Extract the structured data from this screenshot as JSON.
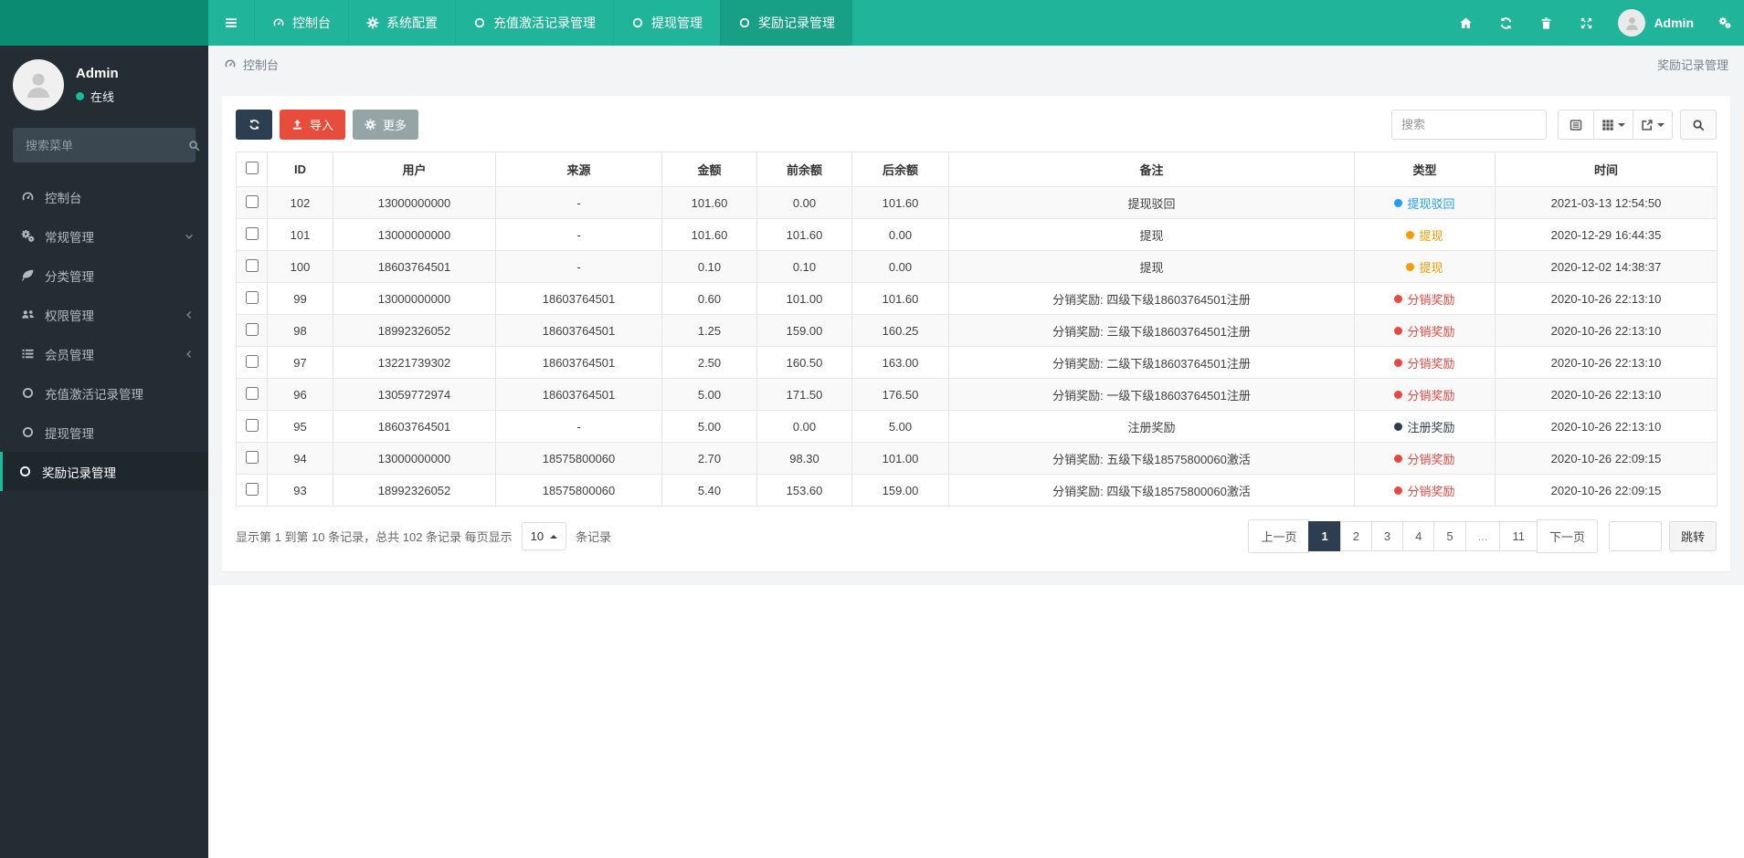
{
  "topnav": {
    "menu_icon": "menu",
    "items": [
      {
        "label": "控制台",
        "icon": "dashboard",
        "active": false
      },
      {
        "label": "系统配置",
        "icon": "gear",
        "active": false
      },
      {
        "label": "充值激活记录管理",
        "icon": "circle",
        "active": false
      },
      {
        "label": "提现管理",
        "icon": "circle",
        "active": false
      },
      {
        "label": "奖励记录管理",
        "icon": "circle",
        "active": true
      }
    ],
    "right_icons": [
      "home",
      "refresh",
      "trash",
      "expand"
    ],
    "user_name": "Admin",
    "settings_icon": "cogs"
  },
  "sidebar": {
    "user": {
      "name": "Admin",
      "status": "在线"
    },
    "search_placeholder": "搜索菜单",
    "search_icon": "search",
    "items": [
      {
        "label": "控制台",
        "icon": "dashboard"
      },
      {
        "label": "常规管理",
        "icon": "cogs",
        "chevron": "down"
      },
      {
        "label": "分类管理",
        "icon": "leaf"
      },
      {
        "label": "权限管理",
        "icon": "users",
        "chevron": "left"
      },
      {
        "label": "会员管理",
        "icon": "list",
        "chevron": "left"
      },
      {
        "label": "充值激活记录管理",
        "icon": "circle"
      },
      {
        "label": "提现管理",
        "icon": "circle"
      },
      {
        "label": "奖励记录管理",
        "icon": "circle",
        "active": true
      }
    ]
  },
  "breadcrumb": {
    "icon": "dashboard",
    "left": "控制台",
    "right": "奖励记录管理"
  },
  "toolbar": {
    "refresh_icon": "refresh",
    "import_label": "导入",
    "import_icon": "upload",
    "more_label": "更多",
    "more_icon": "gear",
    "search_placeholder": "搜索",
    "view_buttons": [
      {
        "icon": "detail",
        "caret": false
      },
      {
        "icon": "columns",
        "caret": true
      },
      {
        "icon": "export",
        "caret": true
      }
    ],
    "search_icon": "search"
  },
  "table": {
    "columns": [
      "ID",
      "用户",
      "来源",
      "金额",
      "前余额",
      "后余额",
      "备注",
      "类型",
      "时间"
    ],
    "rows": [
      {
        "id": "102",
        "user": "13000000000",
        "source": "-",
        "amount": "101.60",
        "before": "0.00",
        "after": "101.60",
        "remark": "提现驳回",
        "type_label": "提现驳回",
        "type_color": "#1e9fff",
        "time": "2021-03-13 12:54:50"
      },
      {
        "id": "101",
        "user": "13000000000",
        "source": "-",
        "amount": "101.60",
        "before": "101.60",
        "after": "0.00",
        "remark": "提现",
        "type_label": "提现",
        "type_color": "#ff9900",
        "time": "2020-12-29 16:44:35"
      },
      {
        "id": "100",
        "user": "18603764501",
        "source": "-",
        "amount": "0.10",
        "before": "0.10",
        "after": "0.00",
        "remark": "提现",
        "type_label": "提现",
        "type_color": "#ff9900",
        "time": "2020-12-02 14:38:37"
      },
      {
        "id": "99",
        "user": "13000000000",
        "source": "18603764501",
        "amount": "0.60",
        "before": "101.00",
        "after": "101.60",
        "remark": "分销奖励: 四级下级18603764501注册",
        "type_label": "分销奖励",
        "type_color": "#e8483f",
        "time": "2020-10-26 22:13:10"
      },
      {
        "id": "98",
        "user": "18992326052",
        "source": "18603764501",
        "amount": "1.25",
        "before": "159.00",
        "after": "160.25",
        "remark": "分销奖励: 三级下级18603764501注册",
        "type_label": "分销奖励",
        "type_color": "#e8483f",
        "time": "2020-10-26 22:13:10"
      },
      {
        "id": "97",
        "user": "13221739302",
        "source": "18603764501",
        "amount": "2.50",
        "before": "160.50",
        "after": "163.00",
        "remark": "分销奖励: 二级下级18603764501注册",
        "type_label": "分销奖励",
        "type_color": "#e8483f",
        "time": "2020-10-26 22:13:10"
      },
      {
        "id": "96",
        "user": "13059772974",
        "source": "18603764501",
        "amount": "5.00",
        "before": "171.50",
        "after": "176.50",
        "remark": "分销奖励: 一级下级18603764501注册",
        "type_label": "分销奖励",
        "type_color": "#e8483f",
        "time": "2020-10-26 22:13:10"
      },
      {
        "id": "95",
        "user": "18603764501",
        "source": "-",
        "amount": "5.00",
        "before": "0.00",
        "after": "5.00",
        "remark": "注册奖励",
        "type_label": "注册奖励",
        "type_color": "#2c3e50",
        "time": "2020-10-26 22:13:10"
      },
      {
        "id": "94",
        "user": "13000000000",
        "source": "18575800060",
        "amount": "2.70",
        "before": "98.30",
        "after": "101.00",
        "remark": "分销奖励: 五级下级18575800060激活",
        "type_label": "分销奖励",
        "type_color": "#e8483f",
        "time": "2020-10-26 22:09:15"
      },
      {
        "id": "93",
        "user": "18992326052",
        "source": "18575800060",
        "amount": "5.40",
        "before": "153.60",
        "after": "159.00",
        "remark": "分销奖励: 四级下级18575800060激活",
        "type_label": "分销奖励",
        "type_color": "#e8483f",
        "time": "2020-10-26 22:09:15"
      }
    ]
  },
  "footer": {
    "info_prefix": "显示第 1 到第 10 条记录，总共 102 条记录 每页显示",
    "page_size": "10",
    "info_suffix": "条记录",
    "pages": [
      {
        "label": "上一页"
      },
      {
        "label": "1",
        "active": true
      },
      {
        "label": "2"
      },
      {
        "label": "3"
      },
      {
        "label": "4"
      },
      {
        "label": "5"
      },
      {
        "label": "..."
      },
      {
        "label": "11"
      },
      {
        "label": "下一页"
      }
    ],
    "jump_label": "跳转"
  }
}
